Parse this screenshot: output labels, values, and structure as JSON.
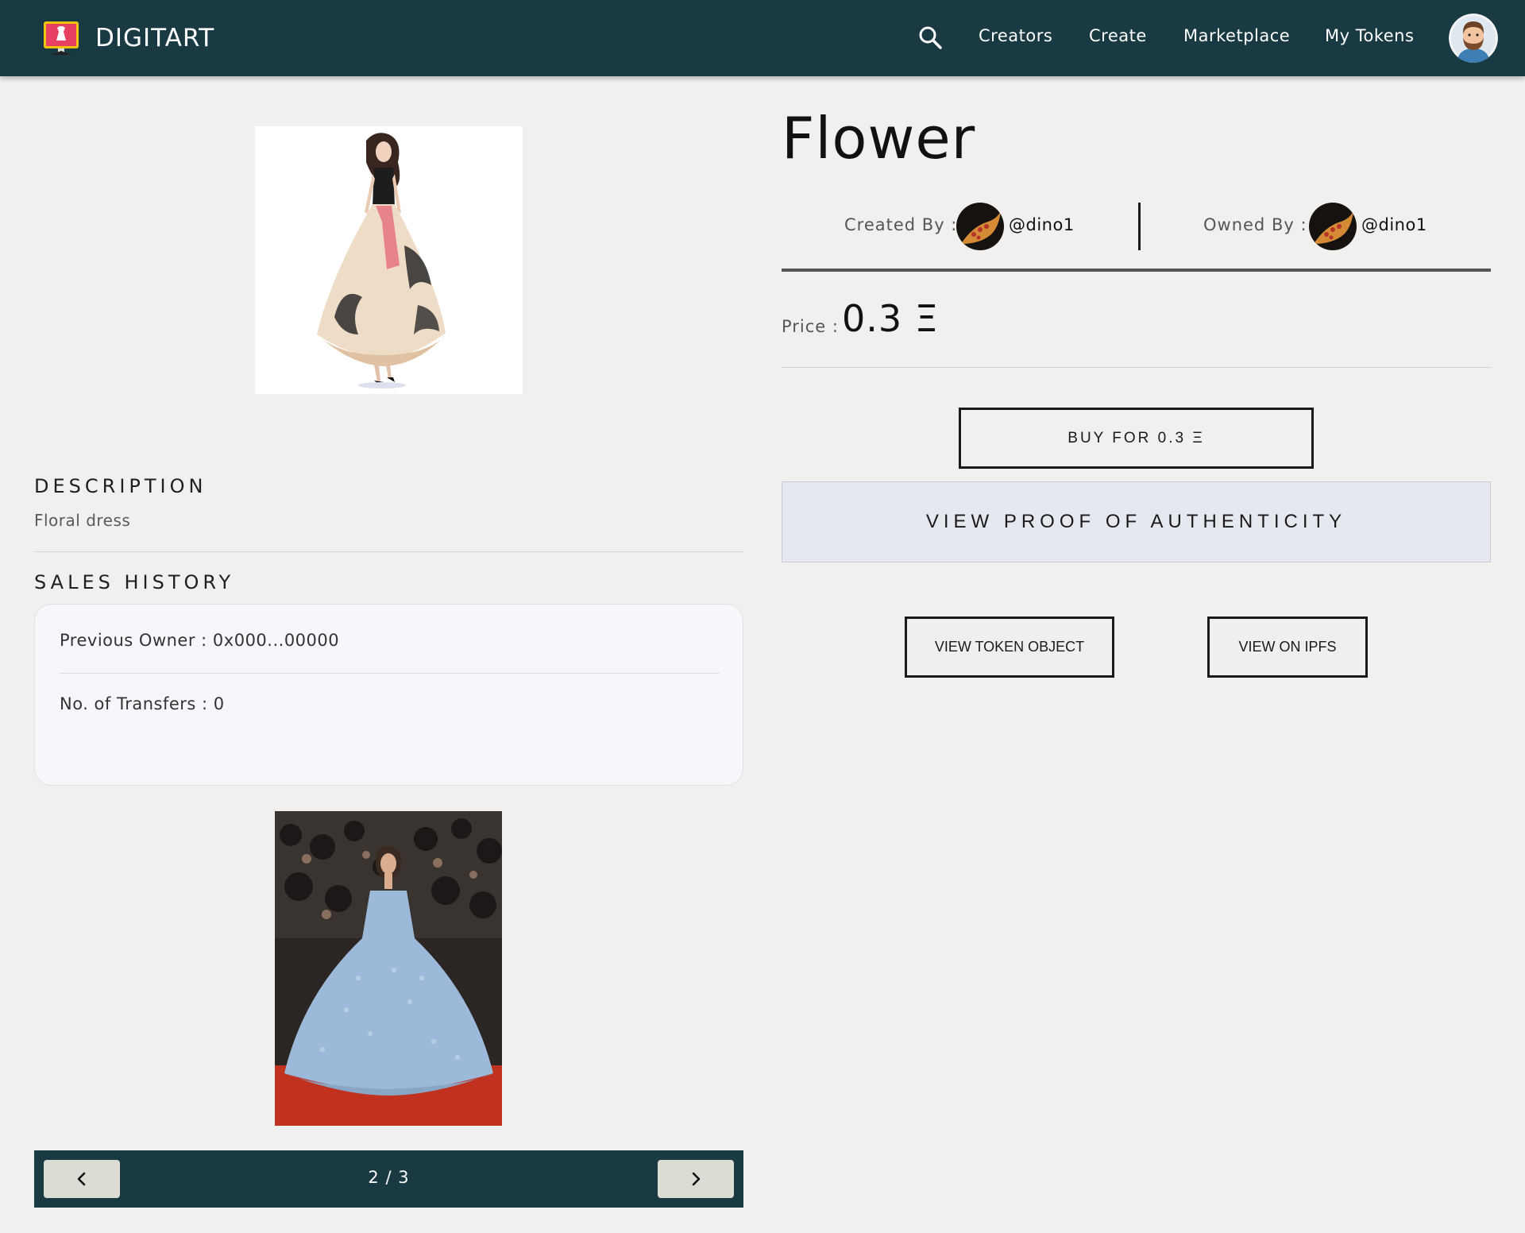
{
  "nav": {
    "brand": "DIGITART",
    "links": [
      "Creators",
      "Create",
      "Marketplace",
      "My Tokens"
    ],
    "search_icon": "search-icon",
    "avatar_icon": "user-avatar"
  },
  "description": {
    "heading": "DESCRIPTION",
    "text": "Floral dress"
  },
  "sales_history": {
    "heading": "SALES HISTORY",
    "previous_owner": "Previous Owner : 0x000...00000",
    "transfers": "No. of Transfers : 0"
  },
  "pager": {
    "label": "2 / 3",
    "prev_icon": "chevron-left-icon",
    "next_icon": "chevron-right-icon"
  },
  "token": {
    "title": "Flower",
    "created_by_label": "Created By :",
    "created_by_handle": "@dino1",
    "owned_by_label": "Owned By :",
    "owned_by_handle": "@dino1",
    "price_label": "Price :",
    "price_value": "0.3 Ξ"
  },
  "actions": {
    "buy": "BUY FOR 0.3 Ξ",
    "proof": "VIEW PROOF OF AUTHENTICITY",
    "view_token_object": "VIEW TOKEN OBJECT",
    "view_on_ipfs": "VIEW ON IPFS"
  },
  "colors": {
    "navbar": "#193a43",
    "background": "#f1f0ee",
    "proof_bg": "#e6e8ef",
    "pager_btn": "#dcdbd4"
  }
}
